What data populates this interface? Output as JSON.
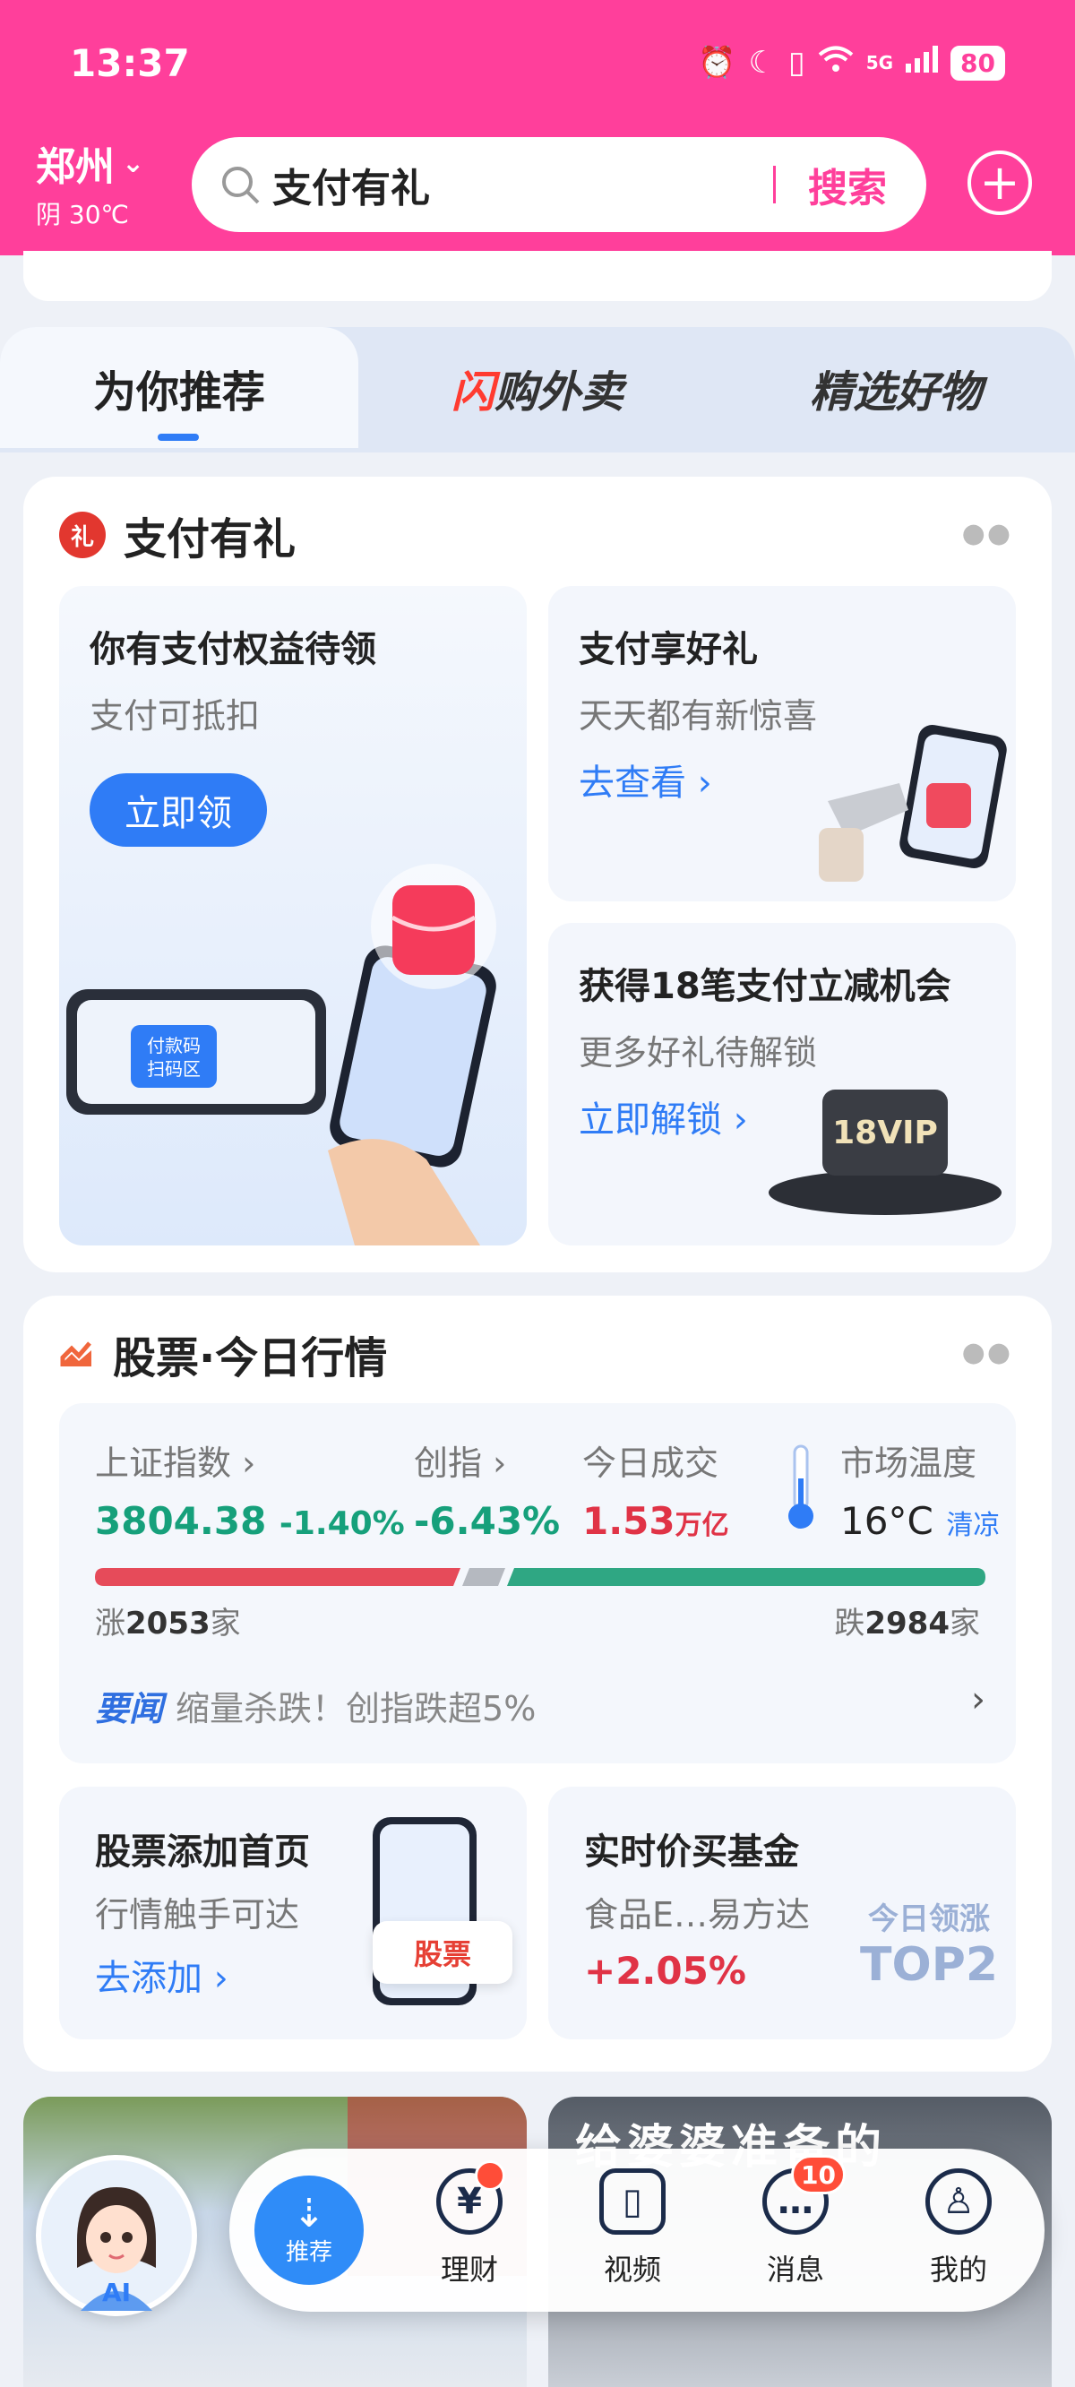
{
  "status_bar": {
    "time": "13:37",
    "network": "5G",
    "battery": "80"
  },
  "header": {
    "city": "郑州",
    "weather": "阴 30℃",
    "search_keyword": "支付有礼",
    "search_button": "搜索"
  },
  "tabs": [
    {
      "label": "为你推荐"
    },
    {
      "label_part1": "闪",
      "label_part2": "购外卖"
    },
    {
      "label": "精选好物"
    }
  ],
  "pay_gift": {
    "title": "支付有礼",
    "card_main": {
      "title": "你有支付权益待领",
      "subtitle": "支付可抵扣",
      "button": "立即领",
      "illus_text1": "付款码",
      "illus_text2": "扫码区"
    },
    "card_right_top": {
      "title": "支付享好礼",
      "subtitle": "天天都有新惊喜",
      "link": "去查看 ›"
    },
    "card_right_bottom": {
      "title": "获得18笔支付立减机会",
      "subtitle": "更多好礼待解锁",
      "link": "立即解锁 ›",
      "vip_badge": "18VIP"
    }
  },
  "stocks": {
    "title": "股票·今日行情",
    "sh_index": {
      "label": "上证指数 ›",
      "value": "3804.38",
      "change": "-1.40%"
    },
    "chinext": {
      "label": "创指 ›",
      "change": "-6.43%"
    },
    "turnover": {
      "label": "今日成交",
      "value": "1.53",
      "unit": "万亿"
    },
    "temperature": {
      "label": "市场温度",
      "value": "16°C",
      "desc": "清凉"
    },
    "rise": {
      "prefix": "涨",
      "count": "2053",
      "suffix": "家"
    },
    "fall": {
      "prefix": "跌",
      "count": "2984",
      "suffix": "家"
    },
    "rise_fraction": 0.41,
    "news": {
      "tag": "要闻",
      "text": "缩量杀跌！创指跌超5%"
    },
    "card_add": {
      "title": "股票添加首页",
      "subtitle": "行情触手可达",
      "link": "去添加 ›",
      "badge": "股票"
    },
    "card_fund": {
      "title": "实时价买基金",
      "subtitle": "食品E…易方达",
      "change": "+2.05%",
      "rank_label": "今日领涨",
      "rank": "TOP2"
    }
  },
  "feed": {
    "banner_text": "给婆婆准备的"
  },
  "bottom_nav": {
    "recommend": "推荐",
    "items": [
      {
        "label": "理财",
        "glyph": "¥"
      },
      {
        "label": "视频",
        "glyph": "▯"
      },
      {
        "label": "消息",
        "glyph": "…",
        "badge": "10"
      },
      {
        "label": "我的",
        "glyph": "♙"
      }
    ],
    "ai_label": "AI"
  },
  "colors": {
    "brand_pink": "#ff3f9b",
    "blue": "#2f7cf6",
    "rise_red": "#e03346",
    "fall_green": "#16a07b"
  }
}
